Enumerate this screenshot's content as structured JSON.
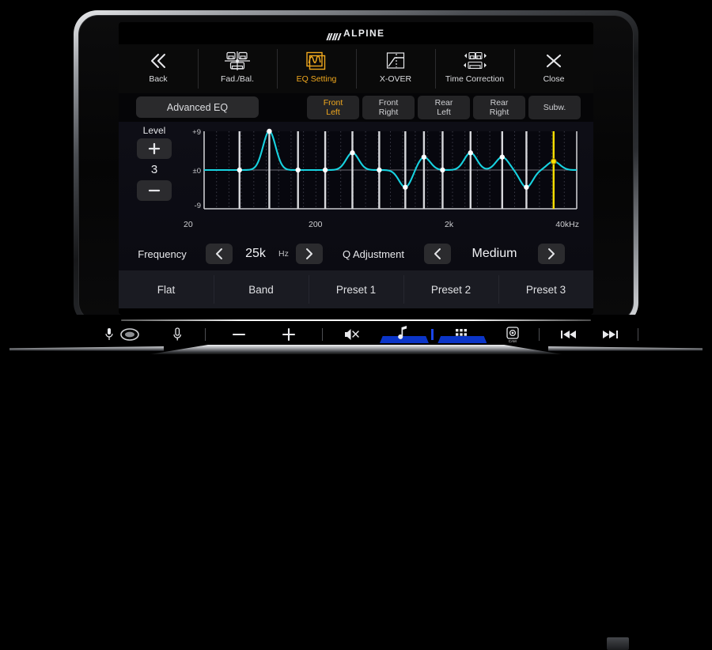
{
  "device": {
    "brand": "ALPINE"
  },
  "toolbar": [
    {
      "label": "Back",
      "icon": "chevron-double-left-icon",
      "active": false
    },
    {
      "label": "Fad./Bal.",
      "icon": "fader-balance-icon",
      "active": false
    },
    {
      "label": "EQ Setting",
      "icon": "equalizer-curve-icon",
      "active": true
    },
    {
      "label": "X-OVER",
      "icon": "crossover-icon",
      "active": false
    },
    {
      "label": "Time Correction",
      "icon": "time-correction-icon",
      "active": false
    },
    {
      "label": "Close",
      "icon": "close-icon",
      "active": false
    }
  ],
  "advanced_eq": {
    "label": "Advanced EQ"
  },
  "speakers": [
    {
      "line1": "Front",
      "line2": "Left",
      "selected": true
    },
    {
      "line1": "Front",
      "line2": "Right",
      "selected": false
    },
    {
      "line1": "Rear",
      "line2": "Left",
      "selected": false
    },
    {
      "line1": "Rear",
      "line2": "Right",
      "selected": false
    },
    {
      "line1": "Subw.",
      "line2": "",
      "selected": false
    }
  ],
  "level": {
    "label": "Level",
    "value": "3",
    "plus": "+",
    "minus": "−"
  },
  "frequency": {
    "label": "Frequency",
    "value": "25k",
    "unit": "Hz",
    "prev": "‹",
    "next": "›"
  },
  "q_adjustment": {
    "label": "Q Adjustment",
    "value": "Medium",
    "prev": "‹",
    "next": "›"
  },
  "presets": [
    {
      "label": "Flat"
    },
    {
      "label": "Band"
    },
    {
      "label": "Preset 1"
    },
    {
      "label": "Preset 2"
    },
    {
      "label": "Preset 3"
    }
  ],
  "hardware_bar": [
    {
      "icon": "microphone-icon"
    },
    {
      "icon": "power-knob-icon"
    },
    {
      "icon": "mic-mute-icon"
    },
    {
      "icon": "volume-down-icon"
    },
    {
      "icon": "volume-up-icon"
    },
    {
      "icon": "audio-mute-icon"
    },
    {
      "icon": "music-note-icon"
    },
    {
      "icon": "apps-grid-icon"
    },
    {
      "icon": "camera-icon"
    },
    {
      "icon": "previous-track-icon"
    },
    {
      "icon": "next-track-icon"
    }
  ],
  "colors": {
    "accent_amber": "#f0a81e",
    "curve_cyan": "#18d2e0",
    "selected_band": "#ffe000",
    "panel_bg": "#0e0e16",
    "blue_tab": "#0b35c8"
  },
  "chart_data": {
    "type": "line",
    "title": "",
    "xlabel": "",
    "ylabel": "",
    "x_tick_labels": [
      "20",
      "200",
      "2k",
      "40kHz"
    ],
    "x_tick_positions": [
      0.02,
      0.333,
      0.666,
      0.965
    ],
    "y_tick_labels": [
      "+9",
      "±0",
      "-9"
    ],
    "ylim": [
      -9,
      9
    ],
    "grid": true,
    "legend": false,
    "selected_band_index": 12,
    "bands": [
      {
        "freq": "31.5",
        "gain": 0,
        "x": 0.095
      },
      {
        "freq": "63",
        "gain": 9,
        "x": 0.175
      },
      {
        "freq": "125",
        "gain": 0,
        "x": 0.252
      },
      {
        "freq": "200",
        "gain": 0,
        "x": 0.325
      },
      {
        "freq": "315",
        "gain": 4,
        "x": 0.398
      },
      {
        "freq": "500",
        "gain": 0,
        "x": 0.47
      },
      {
        "freq": "800",
        "gain": -4,
        "x": 0.54
      },
      {
        "freq": "1.25k",
        "gain": 3,
        "x": 0.59
      },
      {
        "freq": "2k",
        "gain": 0,
        "x": 0.64
      },
      {
        "freq": "3.15k",
        "gain": 4,
        "x": 0.715
      },
      {
        "freq": "5k",
        "gain": 3,
        "x": 0.8
      },
      {
        "freq": "10k",
        "gain": -4,
        "x": 0.865
      },
      {
        "freq": "25k",
        "gain": 2,
        "x": 0.938
      }
    ]
  }
}
